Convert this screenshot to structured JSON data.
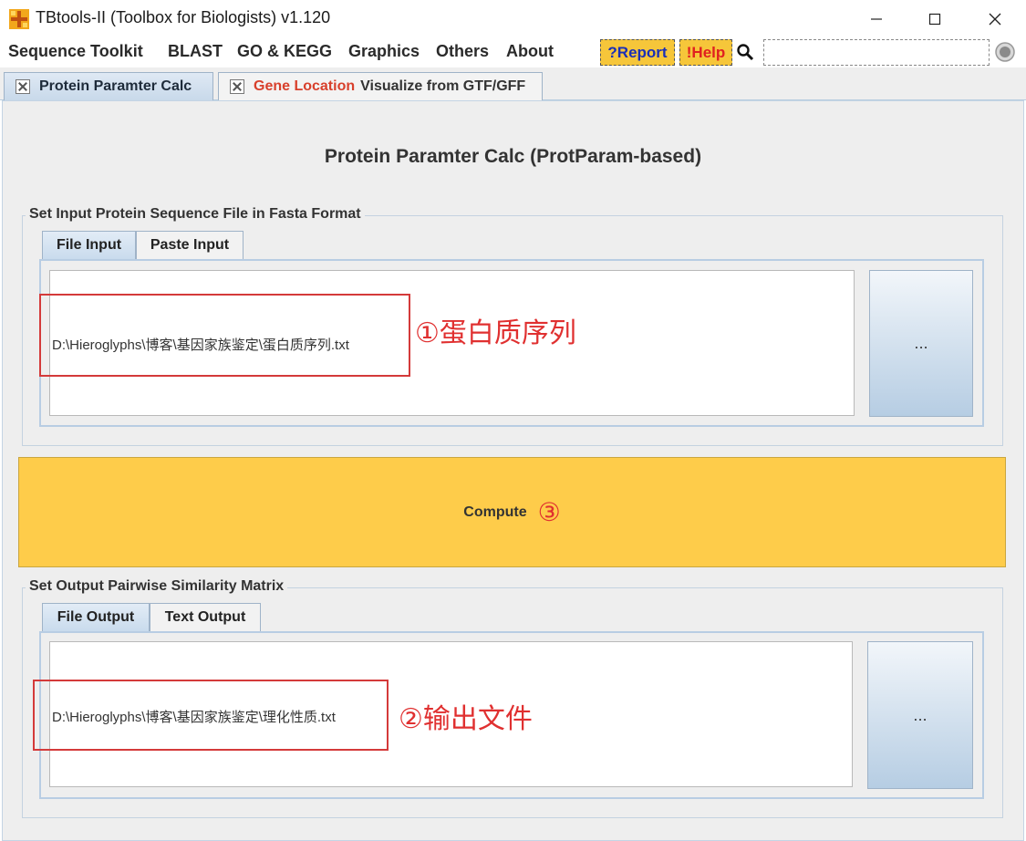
{
  "window": {
    "title": "TBtools-II (Toolbox for Biologists) v1.120",
    "minimize_glyph": "–",
    "maximize_glyph": "☐",
    "close_glyph": "✕"
  },
  "menu": {
    "items": [
      "Sequence Toolkit",
      "BLAST",
      "GO & KEGG",
      "Graphics",
      "Others",
      "About"
    ],
    "report_label": "?Report",
    "help_label": "!Help",
    "search_placeholder": ""
  },
  "tabs": [
    {
      "label": "Protein Paramter Calc",
      "active": true
    },
    {
      "label_red": "Gene Location",
      "label": "Visualize from GTF/GFF",
      "active": false
    }
  ],
  "main": {
    "heading": "Protein Paramter Calc (ProtParam-based)",
    "input_group": {
      "title": "Set Input Protein Sequence File in Fasta Format",
      "tabs": [
        "File Input",
        "Paste Input"
      ],
      "path": "D:\\Hieroglyphs\\博客\\基因家族鉴定\\蛋白质序列.txt",
      "browse_label": "...",
      "annotation": "①蛋白质序列"
    },
    "compute": {
      "label": "Compute",
      "step": "③"
    },
    "output_group": {
      "title": "Set Output Pairwise Similarity Matrix",
      "tabs": [
        "File Output",
        "Text Output"
      ],
      "path": "D:\\Hieroglyphs\\博客\\基因家族鉴定\\理化性质.txt",
      "browse_label": "...",
      "annotation": "②输出文件"
    }
  },
  "colors": {
    "accent_yellow": "#fecc4a",
    "annotation_red": "#e03030",
    "report_blue": "#1a2fb8"
  },
  "icons": {
    "app": "tbtools-grid-icon",
    "search": "search-icon",
    "spinner": "spinner-icon",
    "tab_close": "close-icon"
  }
}
